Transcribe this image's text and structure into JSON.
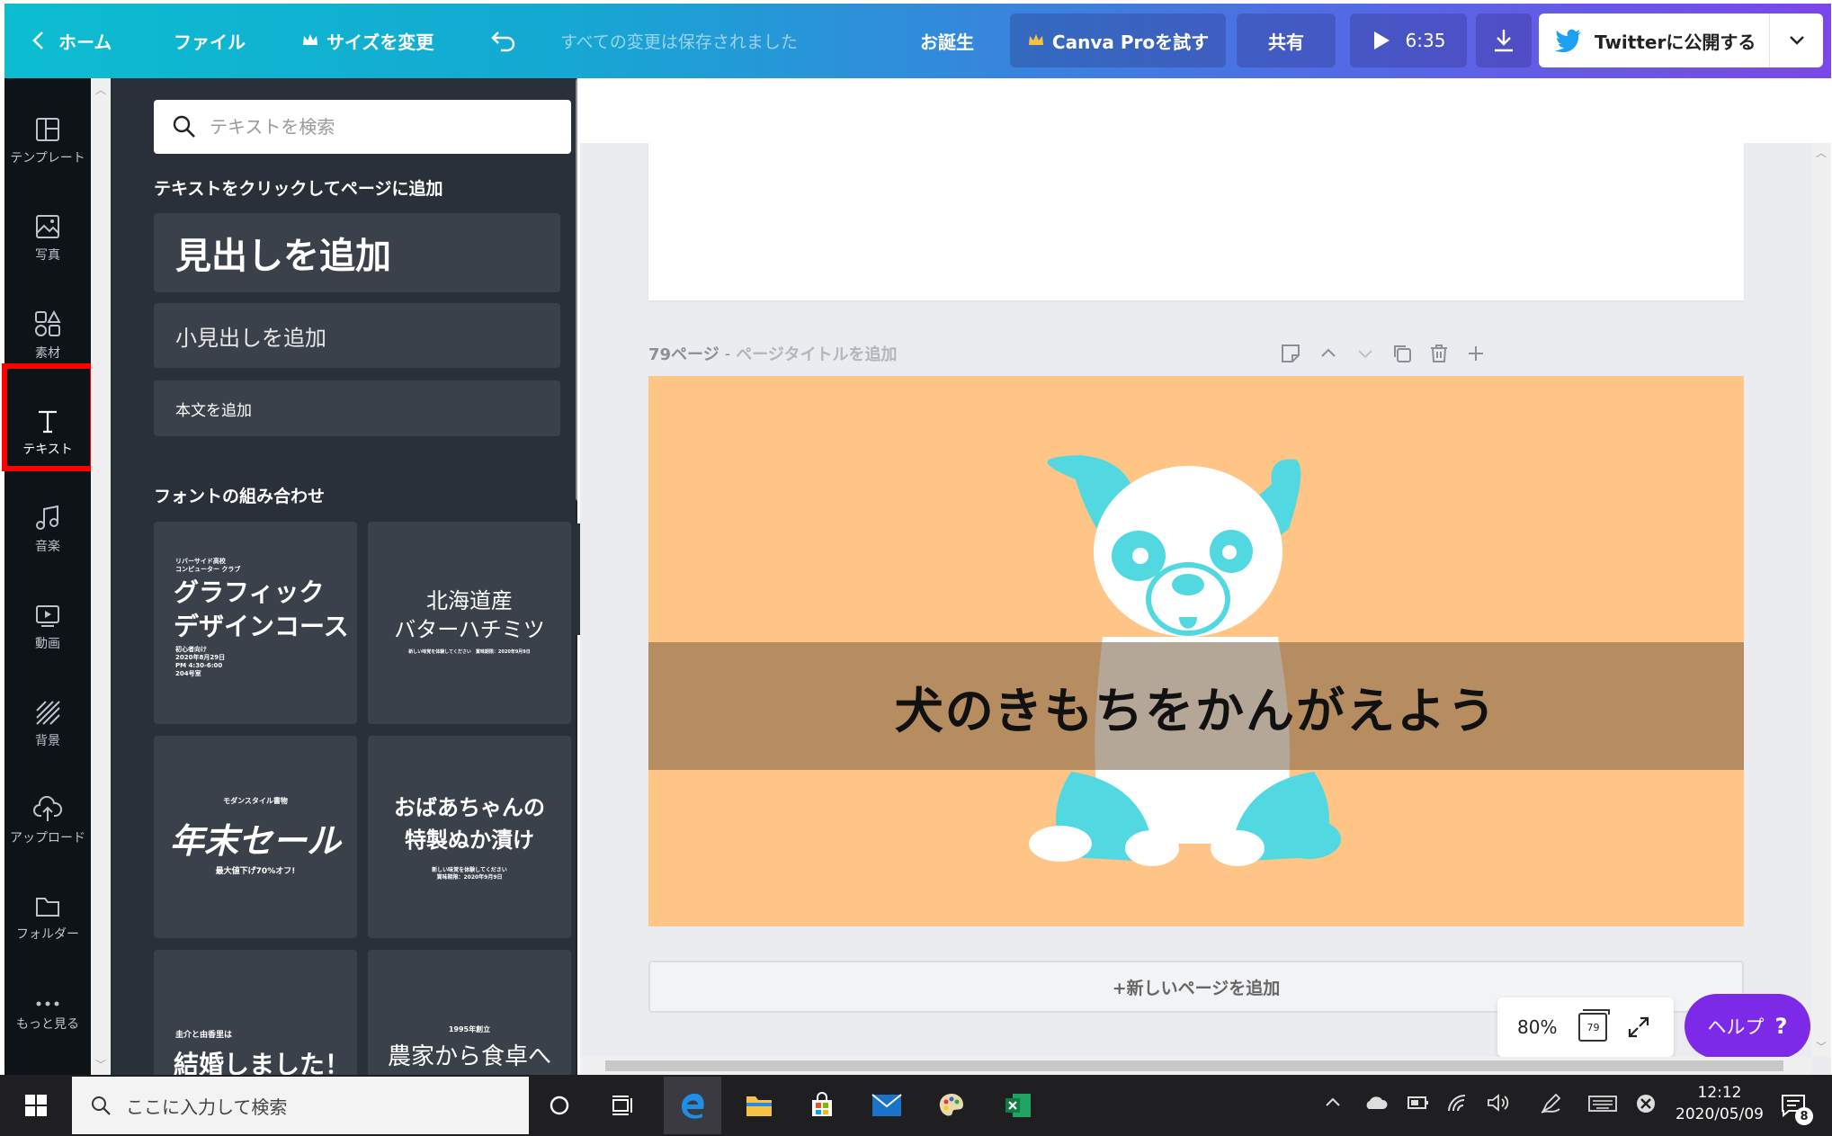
{
  "topbar": {
    "home": "ホーム",
    "file": "ファイル",
    "resize": "サイズを変更",
    "saved_status": "すべての変更は保存されました",
    "design_name": "お誕生",
    "try_pro": "Canva Proを試す",
    "share": "共有",
    "play_time": "6:35",
    "publish_twitter": "Twitterに公開する"
  },
  "rail": {
    "items": [
      {
        "label": "テンプレート"
      },
      {
        "label": "写真"
      },
      {
        "label": "素材"
      },
      {
        "label": "テキスト"
      },
      {
        "label": "音楽"
      },
      {
        "label": "動画"
      },
      {
        "label": "背景"
      },
      {
        "label": "アップロード"
      },
      {
        "label": "フォルダー"
      },
      {
        "label": "もっと見る"
      }
    ]
  },
  "panel": {
    "search_placeholder": "テキストを検索",
    "click_to_add": "テキストをクリックしてページに追加",
    "add_heading": "見出しを追加",
    "add_subheading": "小見出しを追加",
    "add_body": "本文を追加",
    "font_combos_heading": "フォントの組み合わせ",
    "combos": [
      {
        "small_top": "リバーサイド高校\nコンピューター クラブ",
        "main": "グラフィック\nデザインコース",
        "small_bottom": "初心者向け\n2020年8月29日\nPM 4:30-6:00\n204号室"
      },
      {
        "main": "北海道産\nバターハチミツ",
        "small_bottom": "新しい味覚を体験してください　賞味期限：2020年9月9日"
      },
      {
        "small_top": "モダンスタイル書物",
        "main": "年末セール",
        "small_bottom": "最大値下げ70%オフ!"
      },
      {
        "main": "おばあちゃんの\n特製ぬか漬け",
        "small_bottom": "新しい味覚を体験してください\n賞味期限：2020年9月9日"
      },
      {
        "small_top": "圭介と由香里は",
        "main": "結婚しました！"
      },
      {
        "small_top": "1995年創立",
        "main": "農家から食卓へ"
      }
    ]
  },
  "editor": {
    "page_number": "79ページ",
    "page_title_placeholder": "ページタイトルを追加",
    "canvas_text": "犬のきもちをかんがえよう",
    "add_page": "+新しいページを追加",
    "zoom": "80%",
    "page_count": "79",
    "help": "ヘルプ",
    "help_icon": "?"
  },
  "taskbar": {
    "search_placeholder": "ここに入力して検索",
    "time": "12:12",
    "date": "2020/05/09",
    "notification_count": "8"
  },
  "colors": {
    "canvas_bg": "#fec586",
    "banner": "#a08060",
    "dog_cyan": "#52d8e0",
    "help": "#7d2ae8",
    "rail_bg": "#0e1318",
    "panel_bg": "#293039",
    "highlight": "#ff0000"
  }
}
